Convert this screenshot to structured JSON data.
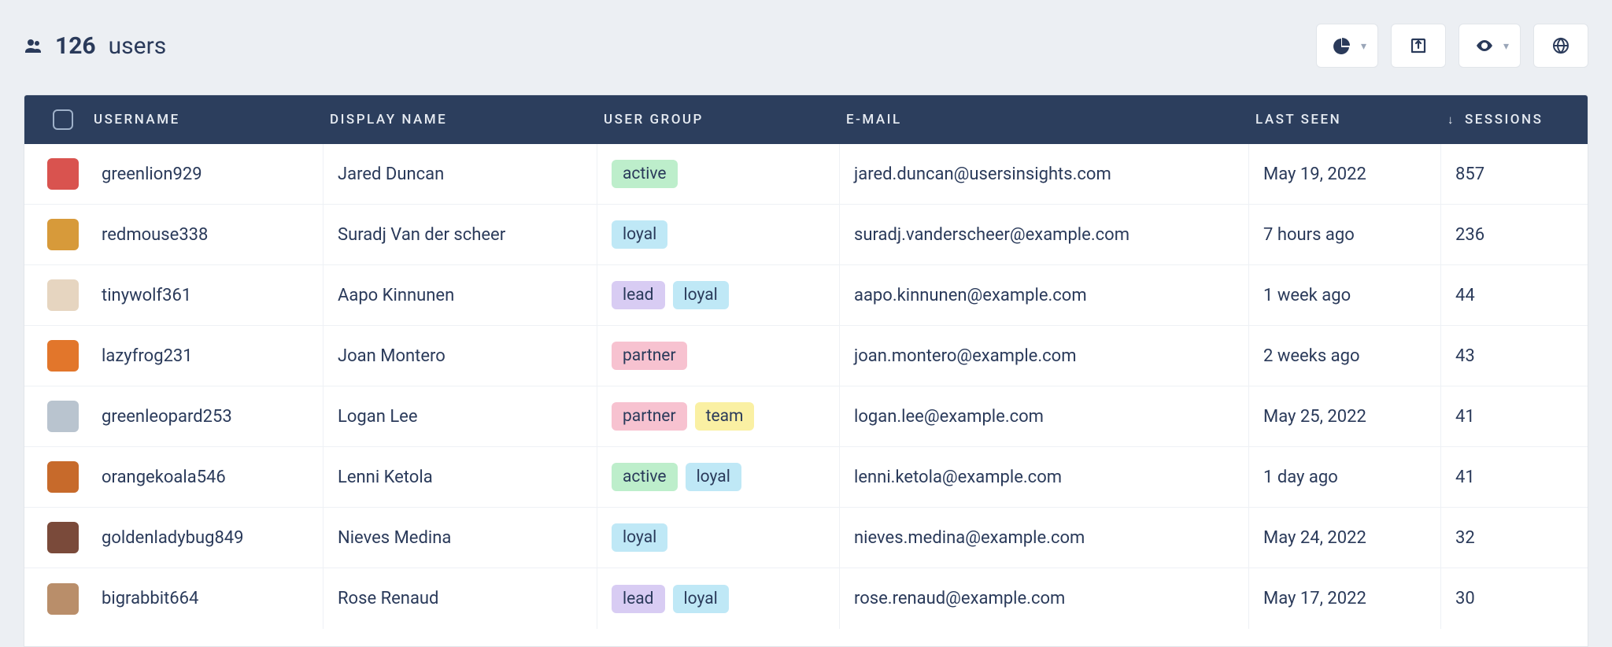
{
  "header": {
    "count": "126",
    "label": "users"
  },
  "toolbar": {
    "segments_button": "Segments",
    "export_button": "Export",
    "visibility_button": "Visibility",
    "globe_button": "Map"
  },
  "columns": {
    "username": "USERNAME",
    "display_name": "DISPLAY NAME",
    "user_group": "USER GROUP",
    "email": "E-MAIL",
    "last_seen": "LAST SEEN",
    "sessions": "SESSIONS"
  },
  "sort": {
    "column": "sessions",
    "direction": "desc",
    "arrow": "↓"
  },
  "tag_colors": {
    "active": "tag-active",
    "loyal": "tag-loyal",
    "lead": "tag-lead",
    "partner": "tag-partner",
    "team": "tag-team"
  },
  "rows": [
    {
      "avatar_color": "#d9534f",
      "username": "greenlion929",
      "display_name": "Jared Duncan",
      "groups": [
        "active"
      ],
      "email": "jared.duncan@usersinsights.com",
      "last_seen": "May 19, 2022",
      "sessions": "857"
    },
    {
      "avatar_color": "#d79a3a",
      "username": "redmouse338",
      "display_name": "Suradj Van der scheer",
      "groups": [
        "loyal"
      ],
      "email": "suradj.vanderscheer@example.com",
      "last_seen": "7 hours ago",
      "sessions": "236"
    },
    {
      "avatar_color": "#e6d5c0",
      "username": "tinywolf361",
      "display_name": "Aapo Kinnunen",
      "groups": [
        "lead",
        "loyal"
      ],
      "email": "aapo.kinnunen@example.com",
      "last_seen": "1 week ago",
      "sessions": "44"
    },
    {
      "avatar_color": "#e2762b",
      "username": "lazyfrog231",
      "display_name": "Joan Montero",
      "groups": [
        "partner"
      ],
      "email": "joan.montero@example.com",
      "last_seen": "2 weeks ago",
      "sessions": "43"
    },
    {
      "avatar_color": "#b9c4cf",
      "username": "greenleopard253",
      "display_name": "Logan Lee",
      "groups": [
        "partner",
        "team"
      ],
      "email": "logan.lee@example.com",
      "last_seen": "May 25, 2022",
      "sessions": "41"
    },
    {
      "avatar_color": "#c76a2b",
      "username": "orangekoala546",
      "display_name": "Lenni Ketola",
      "groups": [
        "active",
        "loyal"
      ],
      "email": "lenni.ketola@example.com",
      "last_seen": "1 day ago",
      "sessions": "41"
    },
    {
      "avatar_color": "#7a4a3a",
      "username": "goldenladybug849",
      "display_name": "Nieves Medina",
      "groups": [
        "loyal"
      ],
      "email": "nieves.medina@example.com",
      "last_seen": "May 24, 2022",
      "sessions": "32"
    },
    {
      "avatar_color": "#b98e6a",
      "username": "bigrabbit664",
      "display_name": "Rose Renaud",
      "groups": [
        "lead",
        "loyal"
      ],
      "email": "rose.renaud@example.com",
      "last_seen": "May 17, 2022",
      "sessions": "30"
    }
  ]
}
